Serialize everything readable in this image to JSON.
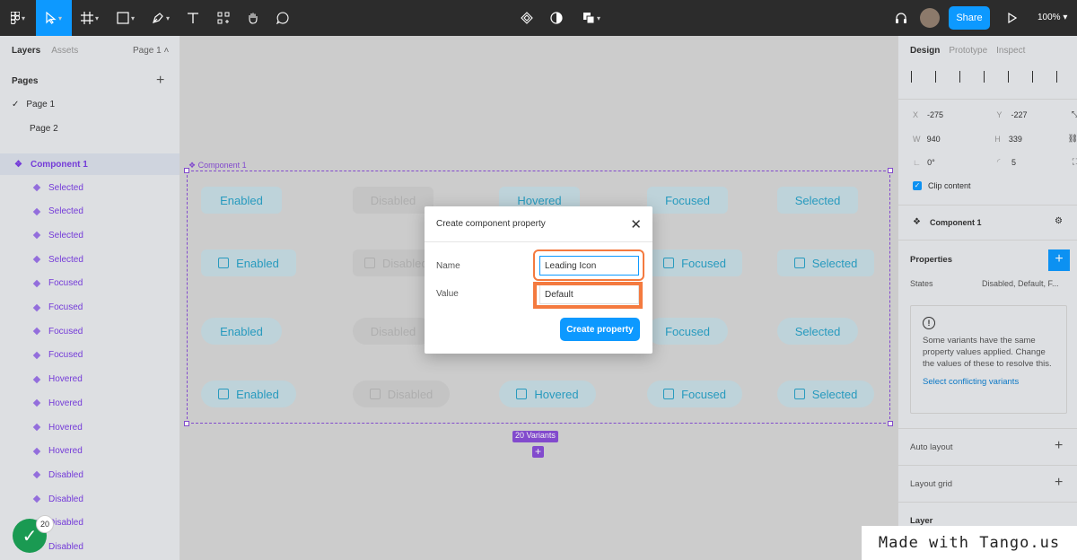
{
  "toolbar": {
    "share_label": "Share",
    "zoom": "100%"
  },
  "left_panel": {
    "tabs": [
      "Layers",
      "Assets"
    ],
    "page_selector": "Page 1",
    "pages_title": "Pages",
    "pages": [
      "Page 1",
      "Page 2"
    ],
    "component": "Component 1",
    "layers": [
      "Selected",
      "Selected",
      "Selected",
      "Selected",
      "Focused",
      "Focused",
      "Focused",
      "Focused",
      "Hovered",
      "Hovered",
      "Hovered",
      "Hovered",
      "Disabled",
      "Disabled",
      "Disabled",
      "Disabled"
    ]
  },
  "canvas": {
    "frame_label": "Component 1",
    "variants_badge": "20 Variants",
    "row1": [
      "Enabled",
      "Disabled",
      "Hovered",
      "Focused",
      "Selected"
    ],
    "row2": [
      "Enabled",
      "Disabled",
      "Focused",
      "Selected"
    ],
    "row3": [
      "Enabled",
      "Disabled",
      "Focused",
      "Selected"
    ],
    "row4": [
      "Enabled",
      "Disabled",
      "Hovered",
      "Focused",
      "Selected"
    ]
  },
  "modal": {
    "title": "Create component property",
    "name_label": "Name",
    "name_value": "Leading Icon",
    "value_label": "Value",
    "value_value": "Default",
    "button": "Create property"
  },
  "right_panel": {
    "tabs": [
      "Design",
      "Prototype",
      "Inspect"
    ],
    "x": "-275",
    "y": "-227",
    "w": "940",
    "h": "339",
    "rotation": "0°",
    "radius": "5",
    "clip_label": "Clip content",
    "component": "Component 1",
    "properties_title": "Properties",
    "states_label": "States",
    "states_value": "Disabled, Default, F...",
    "warning": "Some variants have the same property values applied. Change the values of these to resolve this.",
    "warning_link": "Select conflicting variants",
    "auto_layout": "Auto layout",
    "layout_grid": "Layout grid",
    "layer": "Layer"
  },
  "watermark": "Made with Tango.us",
  "badge_count": "20"
}
